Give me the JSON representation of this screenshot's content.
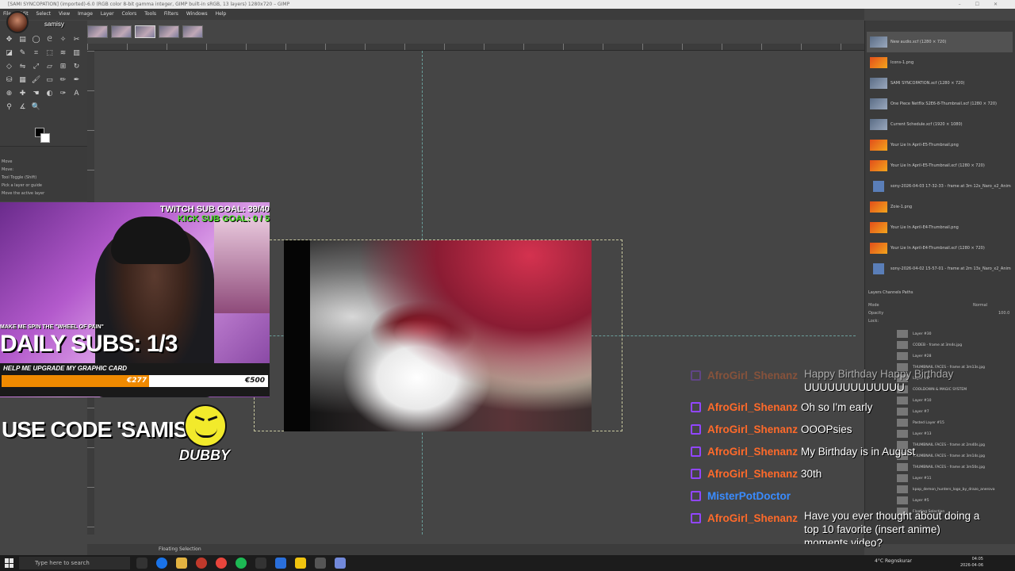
{
  "window": {
    "title": "[SAMI SYNCOPATION] (imported)-6.0 (RGB color 8-bit gamma integer, GIMP built-in sRGB, 13 layers) 1280x720 – GIMP",
    "controls": [
      "–",
      "☐",
      "✕"
    ]
  },
  "menu": [
    "File",
    "Edit",
    "Select",
    "View",
    "Image",
    "Layer",
    "Colors",
    "Tools",
    "Filters",
    "Windows",
    "Help"
  ],
  "streamer": {
    "name": "samisy"
  },
  "tool_options": {
    "title": "Move",
    "subtitle": "Move:",
    "toggle": "Tool Toggle  (Shift)",
    "opt1": "Pick a layer or guide",
    "opt2": "Move the active layer"
  },
  "overlay": {
    "twitch_goal": "TWITCH SUB GOAL: 39/40",
    "kick_goal": "KICK SUB GOAL: 0 / 5",
    "wheel": "MAKE ME SPIN THE \"WHEEL OF PAIN\"",
    "daily_subs": "DAILY SUBS: 1/3",
    "gpu_label": "HELP ME UPGRADE MY GRAPHIC CARD",
    "gpu_current": "€277",
    "gpu_max": "€500",
    "gpu_progress": 0.554,
    "use_code": "USE CODE 'SAMISY'",
    "dubby": "DUBBY"
  },
  "chat": {
    "faded_user": "AfroGirl_Shenanz",
    "faded_msg": "Happy Birthday Happy Birthday",
    "faded_msg2": "UUUUUUUUUUUUU",
    "lines": [
      {
        "user": "AfroGirl_Shenanz",
        "msg": "Oh so I'm early"
      },
      {
        "user": "AfroGirl_Shenanz",
        "msg": "OOOPsies"
      },
      {
        "user": "AfroGirl_Shenanz",
        "msg": "My Birthday is in August"
      },
      {
        "user": "AfroGirl_Shenanz",
        "msg": "30th"
      },
      {
        "user": "MisterPotDoctor",
        "msg": ""
      },
      {
        "user": "AfroGirl_Shenanz",
        "msg": "Have you ever thought about doing a top 10 favorite (insert anime) moments video?"
      }
    ],
    "wrap_lines": [
      "Have you ever thought about doing a",
      "top 10 favorite (insert anime)",
      "moments video?"
    ]
  },
  "images": [
    {
      "label": "New audio.xcf (1280 × 720)"
    },
    {
      "label": "Icons-1.png"
    },
    {
      "label": "SAMI SYNCOPATION.xcf (1280 × 720)"
    },
    {
      "label": "One Piece Netflix S2E6-8-Thumbnail.xcf (1280 × 720)"
    },
    {
      "label": "Current Schedule.xcf (1920 × 1080)"
    },
    {
      "label": "Your Lie In April-E5-Thumbnail.png"
    },
    {
      "label": "Your Lie In April-E5-Thumbnail.xcf (1280 × 720)"
    },
    {
      "label": "sony-2026-04-03 17-32-33 - frame at 3m 12s_Naro_x2_Anim"
    },
    {
      "label": "Zoie-1.png"
    },
    {
      "label": "Your Lie In April-E4-Thumbnail.png"
    },
    {
      "label": "Your Lie In April-E4-Thumbnail.xcf (1280 × 720)"
    },
    {
      "label": "sony-2026-04-02 15-57-01 - frame at 2m 13s_Naro_x2_Anim"
    }
  ],
  "layers_panel": {
    "tabs": "Layers  Channels  Paths",
    "mode_label": "Mode",
    "mode_value": "Normal",
    "opacity_label": "Opacity",
    "opacity_value": "100.0",
    "lock_label": "Lock:",
    "rows": [
      "Layer #30",
      "CODEB - frame at 3m4s.jpg",
      "Layer #28",
      "THUMBNAIL FACES - frame at 3m13s.jpg",
      "Layer #6",
      "COOLDOWN & MAGIC SYSTEM",
      "Layer #10",
      "Layer #7",
      "Pasted Layer #15",
      "Layer #13",
      "THUMBNAIL FACES - frame at 2m40s.jpg",
      "THUMBNAIL FACES - frame at 3m14s.jpg",
      "THUMBNAIL FACES - frame at 3m50s.jpg",
      "Layer #11",
      "kpop_demon_hunters_logo_by_drazo_anerova",
      "Layer #5",
      "Floating Selection"
    ]
  },
  "status": {
    "text": "Floating Selection"
  },
  "taskbar": {
    "search_placeholder": "Type here to search",
    "weather": "4°C  Regnskurar",
    "time": "04:05",
    "date": "2026-04-06"
  }
}
